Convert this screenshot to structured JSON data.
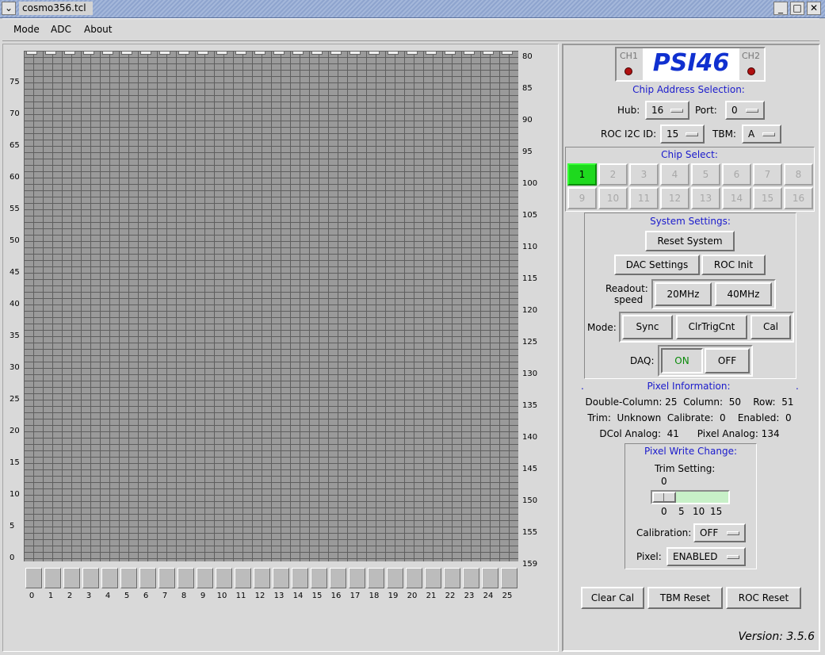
{
  "window": {
    "title": "cosmo356.tcl"
  },
  "menu": [
    "Mode",
    "ADC",
    "About"
  ],
  "grid": {
    "left_row_labels": [
      "75",
      "70",
      "65",
      "60",
      "55",
      "50",
      "45",
      "40",
      "35",
      "30",
      "25",
      "20",
      "15",
      "10",
      "5",
      "0"
    ],
    "right_row_labels": [
      "80",
      "85",
      "90",
      "95",
      "100",
      "105",
      "110",
      "115",
      "120",
      "125",
      "130",
      "135",
      "140",
      "145",
      "150",
      "155",
      "159"
    ],
    "column_labels": [
      "0",
      "1",
      "2",
      "3",
      "4",
      "5",
      "6",
      "7",
      "8",
      "9",
      "10",
      "11",
      "12",
      "13",
      "14",
      "15",
      "16",
      "17",
      "18",
      "19",
      "20",
      "21",
      "22",
      "23",
      "24",
      "25"
    ]
  },
  "logo": {
    "ch1": "CH1",
    "ch2": "CH2",
    "title": "PSI46"
  },
  "chip_address": {
    "heading": "Chip Address Selection:",
    "hub_label": "Hub:",
    "hub_value": "16",
    "port_label": "Port:",
    "port_value": "0",
    "roc_label": "ROC I2C ID:",
    "roc_value": "15",
    "tbm_label": "TBM:",
    "tbm_value": "A"
  },
  "chip_select": {
    "heading": "Chip Select:",
    "chips": [
      "1",
      "2",
      "3",
      "4",
      "5",
      "6",
      "7",
      "8",
      "9",
      "10",
      "11",
      "12",
      "13",
      "14",
      "15",
      "16"
    ],
    "active": "1"
  },
  "system": {
    "heading": "System Settings:",
    "reset": "Reset System",
    "dac": "DAC Settings",
    "roc_init": "ROC Init",
    "readout_label_1": "Readout:",
    "readout_label_2": "speed",
    "speed_20": "20MHz",
    "speed_40": "40MHz",
    "mode_label": "Mode:",
    "sync": "Sync",
    "clrtrig": "ClrTrigCnt",
    "cal": "Cal",
    "daq_label": "DAQ:",
    "daq_on": "ON",
    "daq_off": "OFF"
  },
  "pixel_info": {
    "heading": "Pixel Information:",
    "dot_left": ".",
    "dot_right": ".",
    "line1": "Double-Column: 25  Column:  50    Row:  51",
    "line2": "Trim:  Unknown  Calibrate:  0    Enabled:  0",
    "line3": "DCol Analog:  41      Pixel Analog: 134"
  },
  "pixel_write": {
    "heading": "Pixel Write Change:",
    "trim_label": "Trim Setting:",
    "trim_value": "0",
    "trim_max": 15,
    "scale": [
      "0",
      "5",
      "10",
      "15"
    ],
    "cal_label": "Calibration:",
    "cal_value": "OFF",
    "pixel_label": "Pixel:",
    "pixel_value": "ENABLED"
  },
  "bottom": {
    "clear_cal": "Clear Cal",
    "tbm_reset": "TBM Reset",
    "roc_reset": "ROC Reset"
  },
  "version": "Version: 3.5.6",
  "colors": {
    "accent_text": "#1a1acc",
    "active_chip": "#1ed91e",
    "slider_trough": "#c8f0c8"
  }
}
